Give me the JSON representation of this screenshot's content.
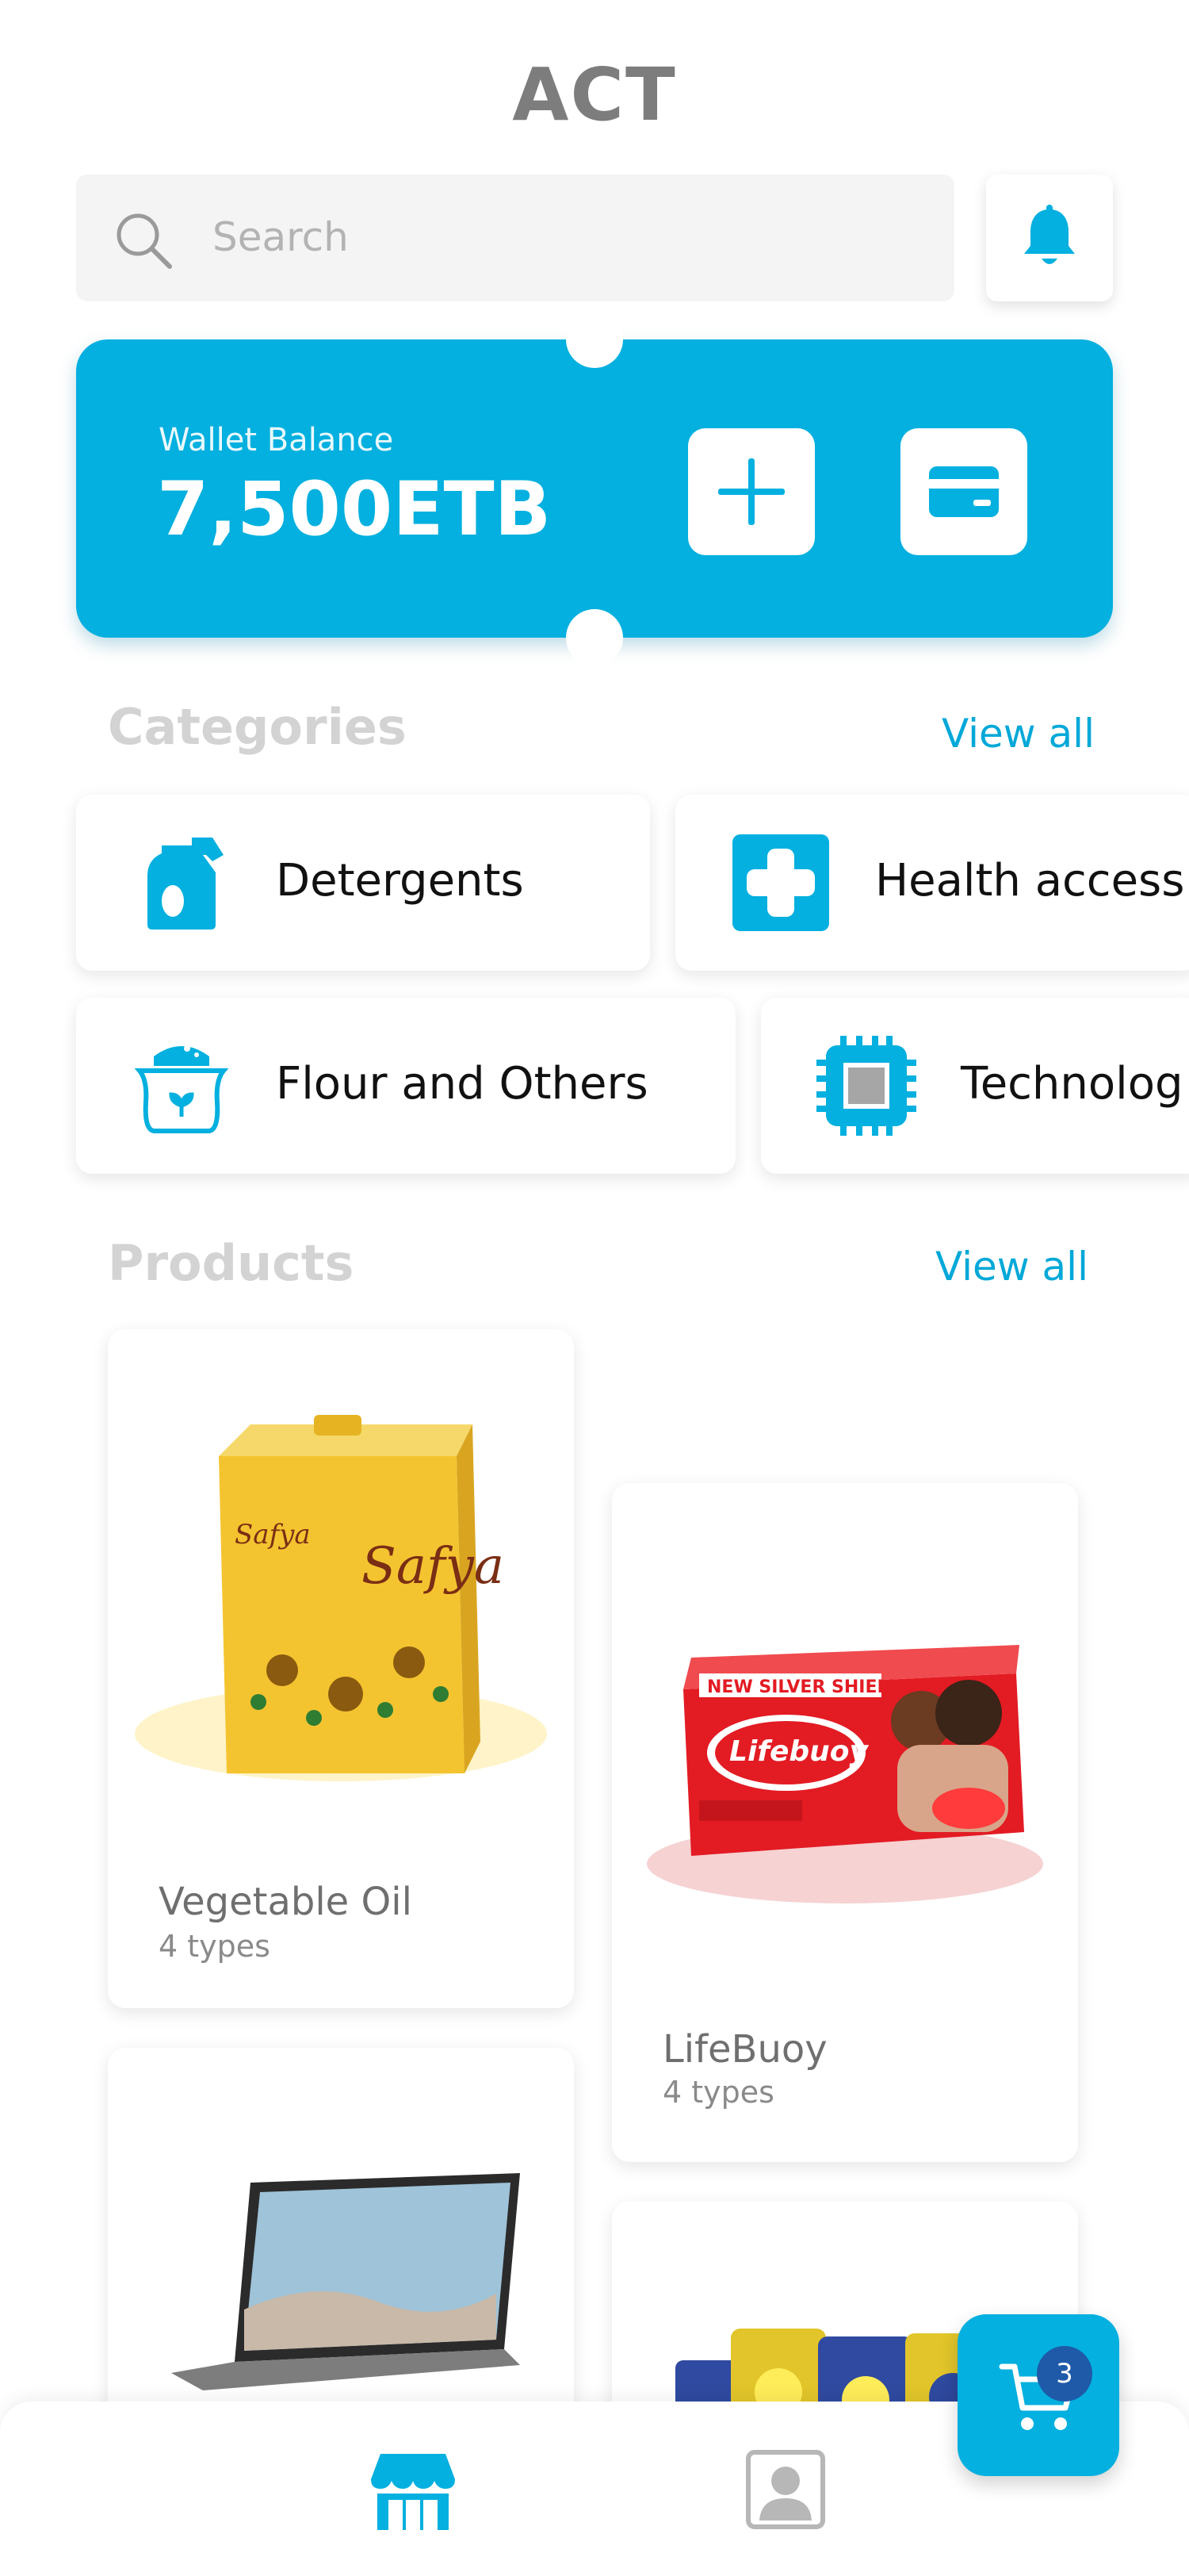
{
  "header": {
    "title": "ACT"
  },
  "search": {
    "placeholder": "Search"
  },
  "wallet": {
    "label": "Wallet Balance",
    "amount": "7,500ETB"
  },
  "categories": {
    "title": "Categories",
    "view_all": "View all",
    "items": [
      {
        "label": "Detergents",
        "icon": "detergent-bottle-icon"
      },
      {
        "label": "Health access",
        "icon": "medical-cross-icon"
      },
      {
        "label": "Flour and Others",
        "icon": "flour-sack-icon"
      },
      {
        "label": "Technolog",
        "icon": "chip-icon"
      }
    ]
  },
  "products": {
    "title": "Products",
    "view_all": "View all",
    "items": [
      {
        "name": "Vegetable Oil",
        "types": "4 types",
        "image": "oil-tin-image"
      },
      {
        "name": "LifeBuoy",
        "types": "4 types",
        "image": "soap-box-image"
      },
      {
        "name": "",
        "types": "",
        "image": "laptop-image"
      },
      {
        "name": "",
        "types": "",
        "image": "snack-packs-image"
      }
    ]
  },
  "cart": {
    "count": "3"
  },
  "colors": {
    "accent": "#03b0df",
    "badge": "#1e5aa8",
    "muted": "#d3d3d3"
  },
  "nav": {
    "items": [
      {
        "icon": "store-icon",
        "active": true
      },
      {
        "icon": "profile-icon",
        "active": false
      }
    ]
  }
}
